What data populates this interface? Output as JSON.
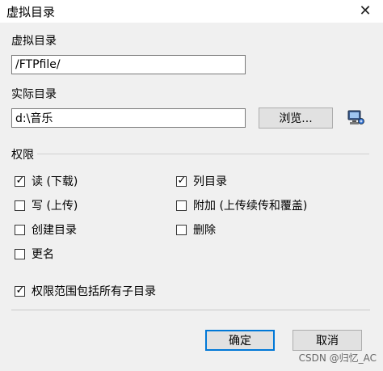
{
  "window": {
    "title": "虚拟目录",
    "close_glyph": "✕"
  },
  "virtual_dir": {
    "label": "虚拟目录",
    "value": "/FTPfile/"
  },
  "actual_dir": {
    "label": "实际目录",
    "value": "d:\\音乐",
    "browse_label": "浏览...",
    "browse_icon": "computer-icon"
  },
  "permissions": {
    "group_label": "权限",
    "items": [
      {
        "label": "读 (下载)",
        "checked": true
      },
      {
        "label": "列目录",
        "checked": true
      },
      {
        "label": "写 (上传)",
        "checked": false
      },
      {
        "label": "附加 (上传续传和覆盖)",
        "checked": false
      },
      {
        "label": "创建目录",
        "checked": false
      },
      {
        "label": "删除",
        "checked": false
      },
      {
        "label": "更名",
        "checked": false
      }
    ],
    "recursive": {
      "label": "权限范围包括所有子目录",
      "checked": true
    }
  },
  "footer": {
    "ok_label": "确定",
    "cancel_label": "取消"
  },
  "watermark": "CSDN @归忆_AC",
  "colors": {
    "dialog_bg": "#f0f0f0",
    "button_bg": "#e1e1e1",
    "accent": "#0078d7"
  }
}
